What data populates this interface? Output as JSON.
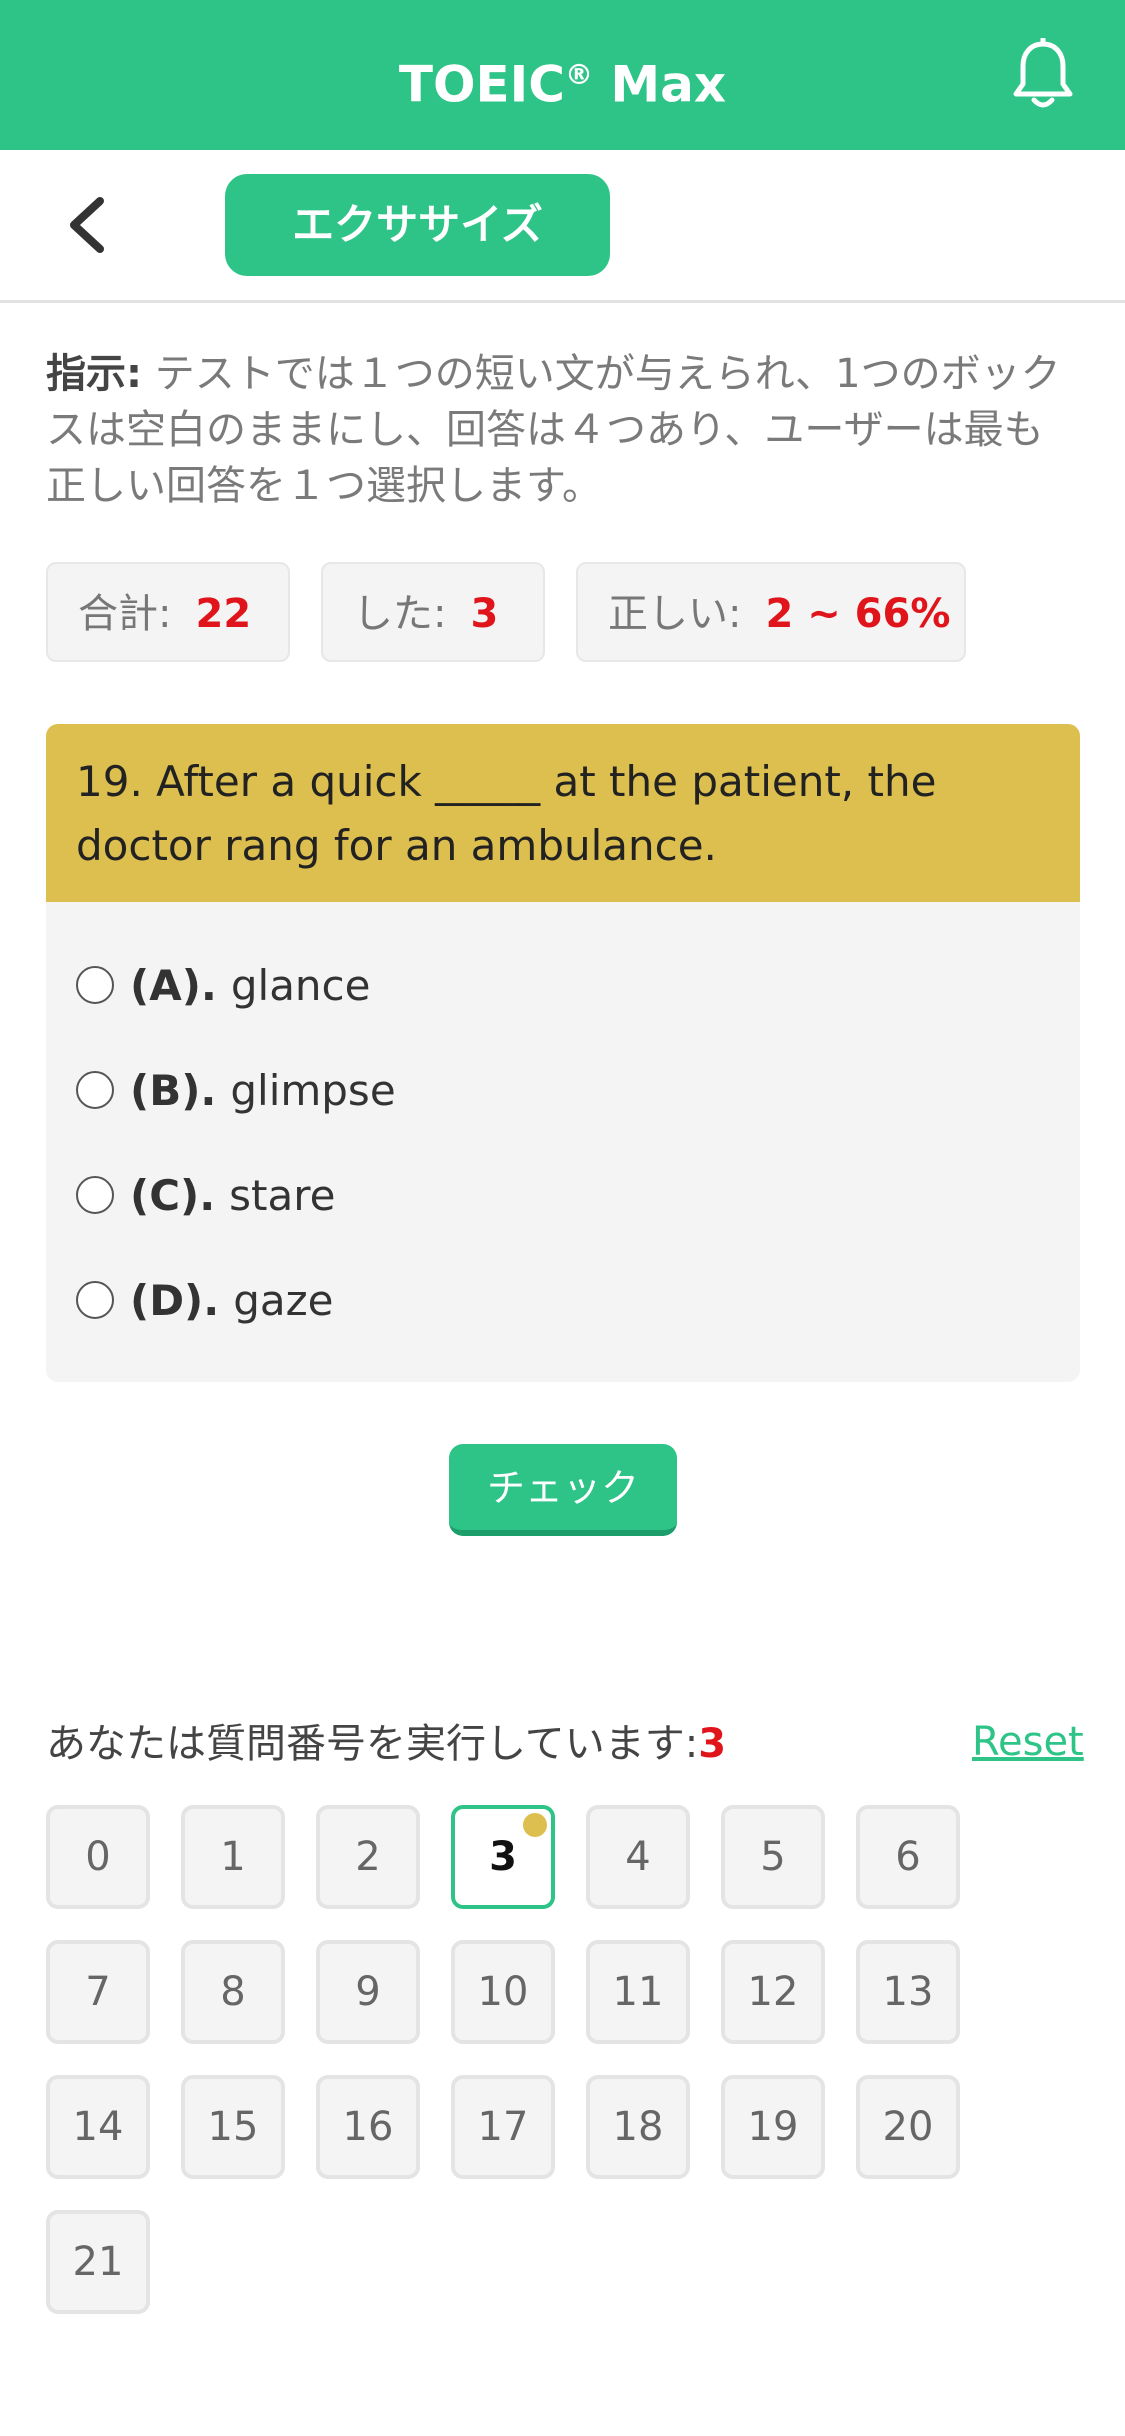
{
  "app": {
    "title": "TOEIC",
    "title_mark": "®",
    "title_suffix": " Max",
    "brand_color": "#2ec488"
  },
  "subheader": {
    "tab_label": "エクササイズ"
  },
  "instructions": {
    "label": "指示:",
    "text": " テストでは１つの短い文が与えられ、1つのボックスは空白のままにし、回答は４つあり、ユーザーは最も正しい回答を１つ選択します。"
  },
  "stats": {
    "total_label": "合計:",
    "total_value": "22",
    "done_label": "した:",
    "done_value": "3",
    "correct_label": "正しい:",
    "correct_value": "2 ~ 66%"
  },
  "question": {
    "text": "19. After a quick _____ at the patient, the doctor rang for an ambulance.",
    "options": [
      {
        "letter": "(A).",
        "text": "glance"
      },
      {
        "letter": "(B).",
        "text": "glimpse"
      },
      {
        "letter": "(C).",
        "text": "stare"
      },
      {
        "letter": "(D).",
        "text": "gaze"
      }
    ]
  },
  "check_label": "チェック",
  "navigator": {
    "running_label": "あなたは質問番号を実行しています:",
    "current": "3",
    "reset_label": "Reset",
    "numbers": [
      "0",
      "1",
      "2",
      "3",
      "4",
      "5",
      "6",
      "7",
      "8",
      "9",
      "10",
      "11",
      "12",
      "13",
      "14",
      "15",
      "16",
      "17",
      "18",
      "19",
      "20",
      "21"
    ],
    "active_index": 3
  },
  "icons": {
    "notification": "bell-icon",
    "back": "chevron-left-icon"
  }
}
